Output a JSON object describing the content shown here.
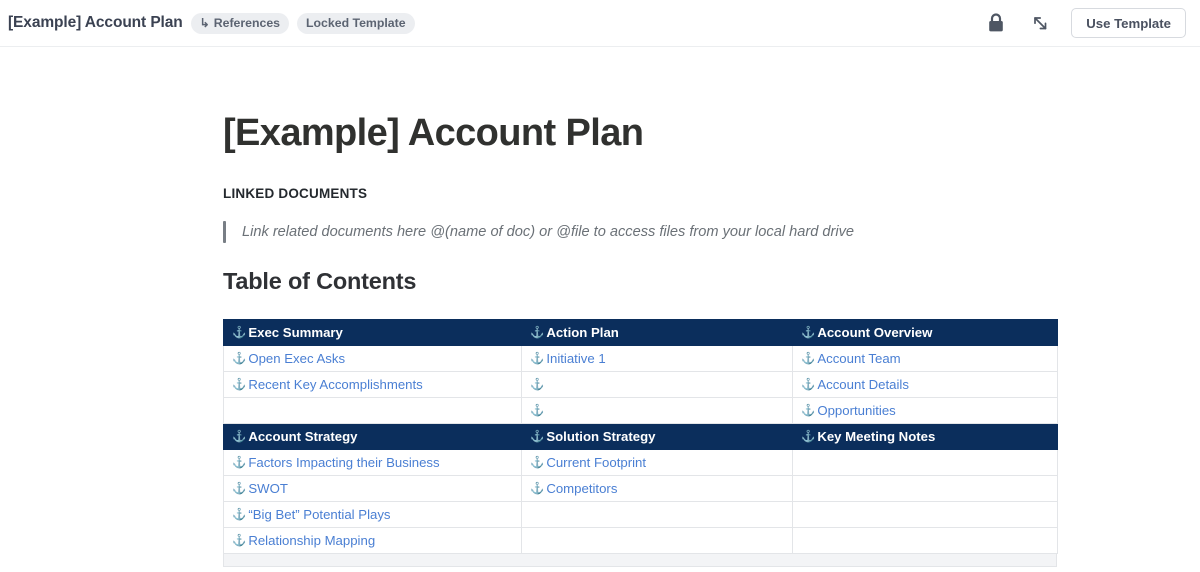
{
  "topbar": {
    "doc_title": "[Example] Account Plan",
    "chips": [
      {
        "icon": "references-arrow-icon",
        "glyph": "↳",
        "label": "References"
      },
      {
        "icon": null,
        "glyph": "",
        "label": "Locked Template"
      }
    ],
    "lock_icon": "lock-icon",
    "expand_icon": "diagonal-arrow-icon",
    "use_template_label": "Use Template"
  },
  "document": {
    "title": "[Example] Account Plan",
    "linked_documents_heading": "LINKED DOCUMENTS",
    "quote_text": "Link related documents here @(name of doc) or @file to access files from your local hard drive",
    "toc_heading": "Table of Contents"
  },
  "toc": {
    "anchor_glyph": "⚓",
    "header_color": "#0b2e5c",
    "link_color": "#4a7fd3",
    "blocks": [
      {
        "headers": [
          "Exec Summary",
          "Action Plan",
          "Account Overview"
        ],
        "rows": [
          [
            "Open Exec Asks",
            "Initiative 1",
            "Account Team"
          ],
          [
            "Recent Key Accomplishments",
            "",
            "Account Details"
          ],
          [
            "",
            "",
            "Opportunities"
          ]
        ]
      },
      {
        "headers": [
          "Account Strategy",
          "Solution Strategy",
          "Key Meeting Notes"
        ],
        "rows": [
          [
            "Factors Impacting their Business",
            "Current Footprint",
            ""
          ],
          [
            "SWOT",
            "Competitors",
            ""
          ],
          [
            "“Big Bet” Potential Plays",
            "",
            ""
          ],
          [
            "Relationship Mapping",
            "",
            ""
          ]
        ]
      }
    ]
  }
}
